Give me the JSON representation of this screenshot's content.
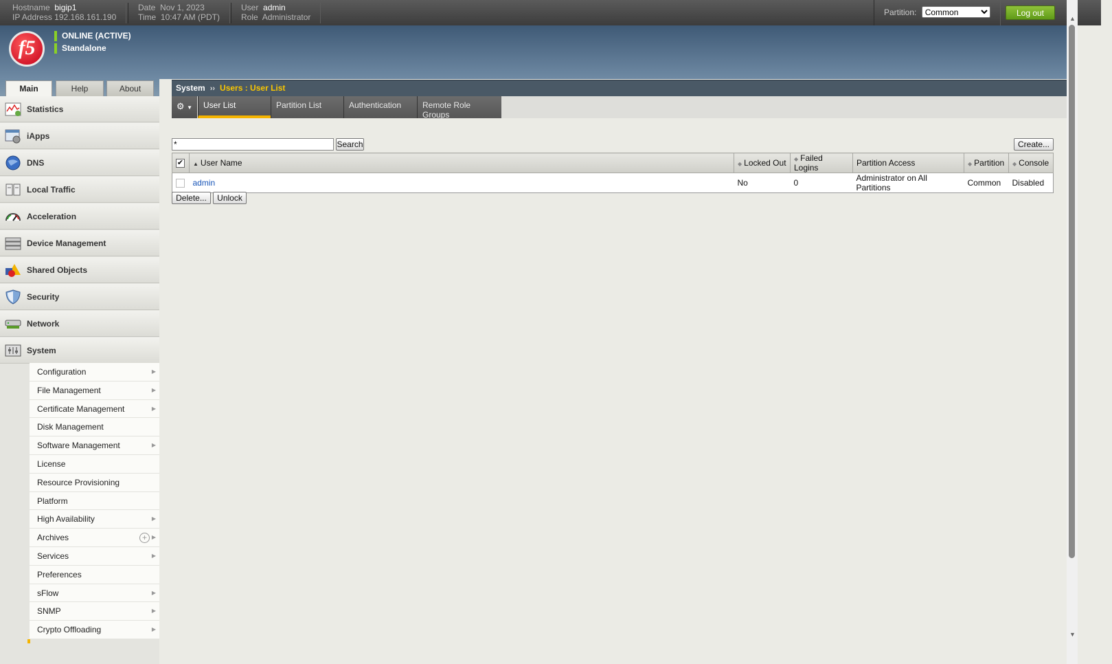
{
  "topbar": {
    "hostname_label": "Hostname",
    "hostname": "bigip1",
    "ip_label": "IP Address",
    "ip": "192.168.161.190",
    "date_label": "Date",
    "date": "Nov 1, 2023",
    "time_label": "Time",
    "time": "10:47 AM (PDT)",
    "user_label": "User",
    "user": "admin",
    "role_label": "Role",
    "role": "Administrator",
    "partition_label": "Partition:",
    "partition_value": "Common",
    "logout_label": "Log out"
  },
  "banner": {
    "logo": "f5",
    "status": "ONLINE (ACTIVE)",
    "mode": "Standalone"
  },
  "left_tabs": [
    {
      "label": "Main",
      "active": true
    },
    {
      "label": "Help",
      "active": false
    },
    {
      "label": "About",
      "active": false
    }
  ],
  "nav": [
    {
      "label": "Statistics",
      "icon": "statistics-icon"
    },
    {
      "label": "iApps",
      "icon": "iapps-icon"
    },
    {
      "label": "DNS",
      "icon": "dns-icon"
    },
    {
      "label": "Local Traffic",
      "icon": "local-traffic-icon"
    },
    {
      "label": "Acceleration",
      "icon": "acceleration-icon"
    },
    {
      "label": "Device Management",
      "icon": "device-management-icon"
    },
    {
      "label": "Shared Objects",
      "icon": "shared-objects-icon"
    },
    {
      "label": "Security",
      "icon": "security-icon"
    },
    {
      "label": "Network",
      "icon": "network-icon"
    },
    {
      "label": "System",
      "icon": "system-icon"
    }
  ],
  "system_submenu": [
    {
      "label": "Configuration",
      "arrow": true
    },
    {
      "label": "File Management",
      "arrow": true
    },
    {
      "label": "Certificate Management",
      "arrow": true
    },
    {
      "label": "Disk Management",
      "arrow": false
    },
    {
      "label": "Software Management",
      "arrow": true
    },
    {
      "label": "License",
      "arrow": false
    },
    {
      "label": "Resource Provisioning",
      "arrow": false
    },
    {
      "label": "Platform",
      "arrow": false
    },
    {
      "label": "High Availability",
      "arrow": true
    },
    {
      "label": "Archives",
      "arrow": true,
      "plus": true
    },
    {
      "label": "Services",
      "arrow": true
    },
    {
      "label": "Preferences",
      "arrow": false
    },
    {
      "label": "sFlow",
      "arrow": true
    },
    {
      "label": "SNMP",
      "arrow": true
    },
    {
      "label": "Crypto Offloading",
      "arrow": true
    }
  ],
  "breadcrumb": {
    "root": "System",
    "separator": "››",
    "current": "Users : User List"
  },
  "tabs": [
    {
      "label": "User List",
      "active": true
    },
    {
      "label": "Partition List",
      "active": false
    },
    {
      "label": "Authentication",
      "active": false
    },
    {
      "label": "Remote Role Groups",
      "active": false
    }
  ],
  "search": {
    "value": "*",
    "button_label": "Search"
  },
  "create_label": "Create...",
  "table": {
    "columns": [
      "User Name",
      "Locked Out",
      "Failed Logins",
      "Partition Access",
      "Partition",
      "Console"
    ],
    "rows": [
      {
        "user_name": "admin",
        "locked_out": "No",
        "failed_logins": "0",
        "partition_access": "Administrator on All Partitions",
        "partition": "Common",
        "console": "Disabled"
      }
    ]
  },
  "actions": {
    "delete_label": "Delete...",
    "unlock_label": "Unlock"
  },
  "colors": {
    "accent": "#f5b400",
    "logout_green": "#6fa81f",
    "breadcrumb_bg": "#4a5966"
  }
}
